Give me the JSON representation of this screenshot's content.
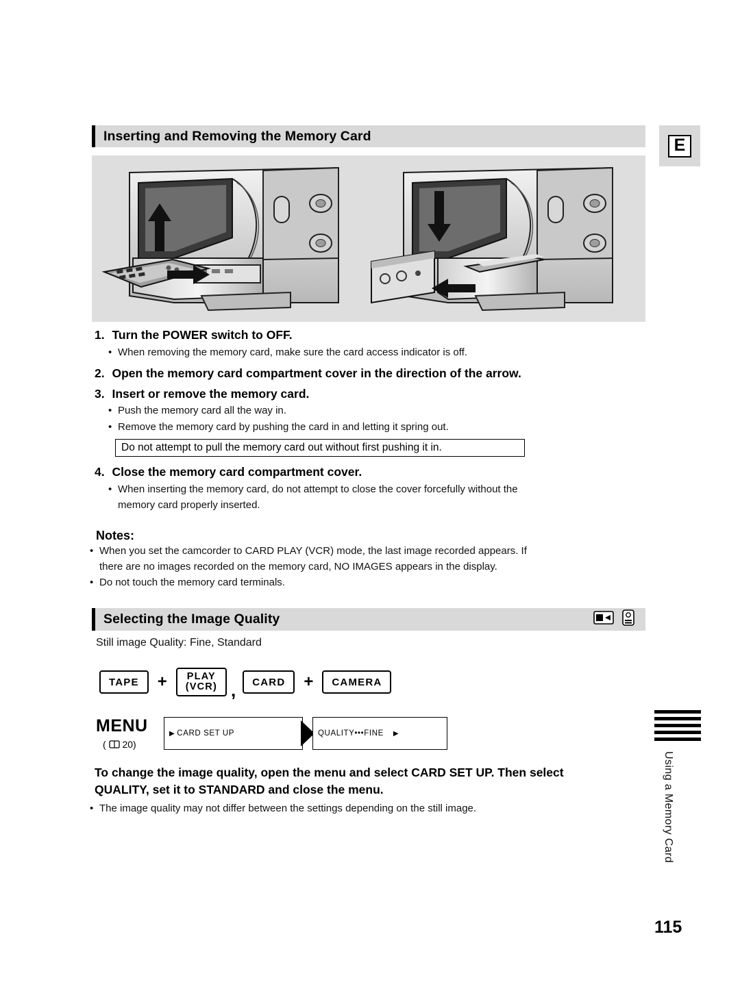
{
  "page": {
    "number": "115",
    "corner_letter": "E",
    "side_tab_text": "Using a Memory Card"
  },
  "section1": {
    "title": "Inserting and Removing the Memory Card",
    "steps": [
      {
        "num": "1.",
        "head": "Turn the POWER switch to OFF.",
        "bullets": [
          "When removing the memory card, make sure the card access indicator is off."
        ]
      },
      {
        "num": "2.",
        "head": "Open the memory card compartment cover in the direction of the arrow.",
        "bullets": []
      },
      {
        "num": "3.",
        "head": "Insert or remove the memory card.",
        "bullets": [
          "Push the memory card all the way in.",
          "Remove the memory card by pushing the card in and letting it spring out."
        ]
      },
      {
        "num": "4.",
        "head": "Close the memory card compartment cover.",
        "bullets": [
          "When inserting the memory card, do not attempt to close the cover forcefully without the",
          "memory card properly inserted."
        ]
      }
    ],
    "boxed_note": "Do not attempt to pull the memory card out without first pushing it in.",
    "notes_head": "Notes:",
    "notes": [
      "When you set the camcorder to CARD PLAY (VCR) mode, the last image recorded appears. If",
      "there are no images recorded on the memory card, NO IMAGES appears in the display.",
      "Do not touch the memory card terminals."
    ]
  },
  "section2": {
    "title": "Selecting the Image Quality",
    "icons": [
      "card-play-icon",
      "card-camera-icon"
    ],
    "subtitle": "Still image Quality: Fine, Standard",
    "mode_buttons": [
      {
        "name": "tape-mode-button",
        "line1": "TAPE",
        "line2": ""
      },
      {
        "name": "plus-1",
        "line1": "+",
        "line2": ""
      },
      {
        "name": "play-vcr-mode-button",
        "line1": "PLAY",
        "line2": "(VCR)"
      },
      {
        "name": "comma-separator",
        "line1": ",",
        "line2": ""
      },
      {
        "name": "card-mode-button",
        "line1": "CARD",
        "line2": ""
      },
      {
        "name": "plus-2",
        "line1": "+",
        "line2": ""
      },
      {
        "name": "camera-mode-button",
        "line1": "CAMERA",
        "line2": ""
      }
    ],
    "menu": {
      "label": "MENU",
      "page_ref": "( 20)",
      "item1": "CARD SET UP",
      "item2": "QUALITY•••FINE"
    },
    "instruction_line1": "To change the image quality, open the menu and select CARD SET UP. Then select",
    "instruction_line2": "QUALITY, set it to STANDARD and close the menu.",
    "instruction_bullet": "The image quality may not differ between the settings depending on the still image."
  }
}
